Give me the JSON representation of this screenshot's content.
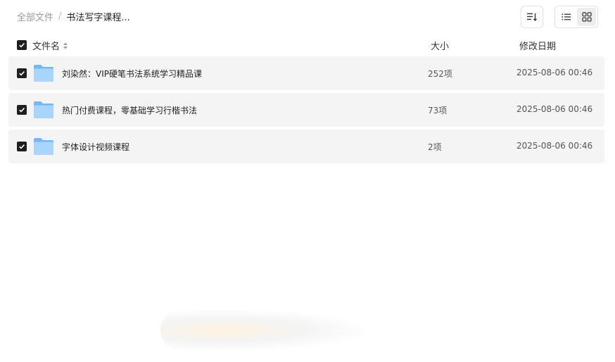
{
  "breadcrumb": {
    "root": "全部文件",
    "separator": "/",
    "current": "书法写字课程..."
  },
  "toolbar": {
    "sort_icon": "sort-icon",
    "view_list_icon": "list-view-icon",
    "view_grid_icon": "grid-view-icon",
    "active_view": "grid"
  },
  "header": {
    "name": "文件名",
    "size": "大小",
    "date": "修改日期"
  },
  "files": [
    {
      "name": "刘染然：VIP硬笔书法系统学习精品课",
      "size": "252项",
      "date": "2025-08-06 00:46",
      "checked": true
    },
    {
      "name": "热门付费课程，零基础学习行楷书法",
      "size": "73项",
      "date": "2025-08-06 00:46",
      "checked": true
    },
    {
      "name": "字体设计视频课程",
      "size": "2项",
      "date": "2025-08-06 00:46",
      "checked": true
    }
  ],
  "colors": {
    "row_bg": "#f4f4f4",
    "checkbox": "#1f1f1f",
    "folder_light": "#a9d4fb",
    "folder_dark": "#74b7f3"
  }
}
